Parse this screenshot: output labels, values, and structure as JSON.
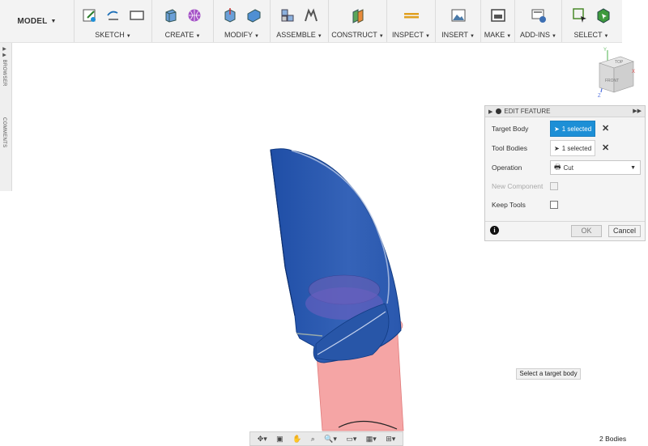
{
  "toolbar": {
    "model_label": "MODEL",
    "groups": [
      {
        "label": "SKETCH",
        "icons": [
          "sketch-icon",
          "line-icon",
          "rectangle-icon"
        ]
      },
      {
        "label": "CREATE",
        "icons": [
          "extrude-icon",
          "sphere-icon"
        ]
      },
      {
        "label": "MODIFY",
        "icons": [
          "press-pull-icon",
          "fillet-icon"
        ]
      },
      {
        "label": "ASSEMBLE",
        "icons": [
          "new-component-icon",
          "joint-icon"
        ]
      },
      {
        "label": "CONSTRUCT",
        "icons": [
          "offset-plane-icon"
        ]
      },
      {
        "label": "INSPECT",
        "icons": [
          "measure-icon"
        ]
      },
      {
        "label": "INSERT",
        "icons": [
          "insert-image-icon"
        ]
      },
      {
        "label": "MAKE",
        "icons": [
          "print-icon"
        ]
      },
      {
        "label": "ADD-INS",
        "icons": [
          "scripts-icon"
        ]
      },
      {
        "label": "SELECT",
        "icons": [
          "select-icon",
          "select-body-icon"
        ]
      }
    ]
  },
  "left_strip": {
    "browser_label": "BROWSER",
    "comments_label": "COMMENTS"
  },
  "viewcube": {
    "top_label": "TOP",
    "front_label": "FRONT",
    "axis_x": "X",
    "axis_y": "Y",
    "axis_z": "Z"
  },
  "edit_feature": {
    "title": "EDIT FEATURE",
    "target_body": {
      "label": "Target Body",
      "value": "1 selected"
    },
    "tool_bodies": {
      "label": "Tool Bodies",
      "value": "1 selected"
    },
    "operation": {
      "label": "Operation",
      "value": "Cut"
    },
    "new_component": {
      "label": "New Component",
      "checked": false
    },
    "keep_tools": {
      "label": "Keep Tools",
      "checked": false
    },
    "ok_label": "OK",
    "cancel_label": "Cancel"
  },
  "tooltip": "Select a target body",
  "status": {
    "bodies": "2 Bodies"
  },
  "colors": {
    "accent": "#1d8fd6",
    "body_blue": "#2f5fb0",
    "body_red": "#f29c9c"
  }
}
